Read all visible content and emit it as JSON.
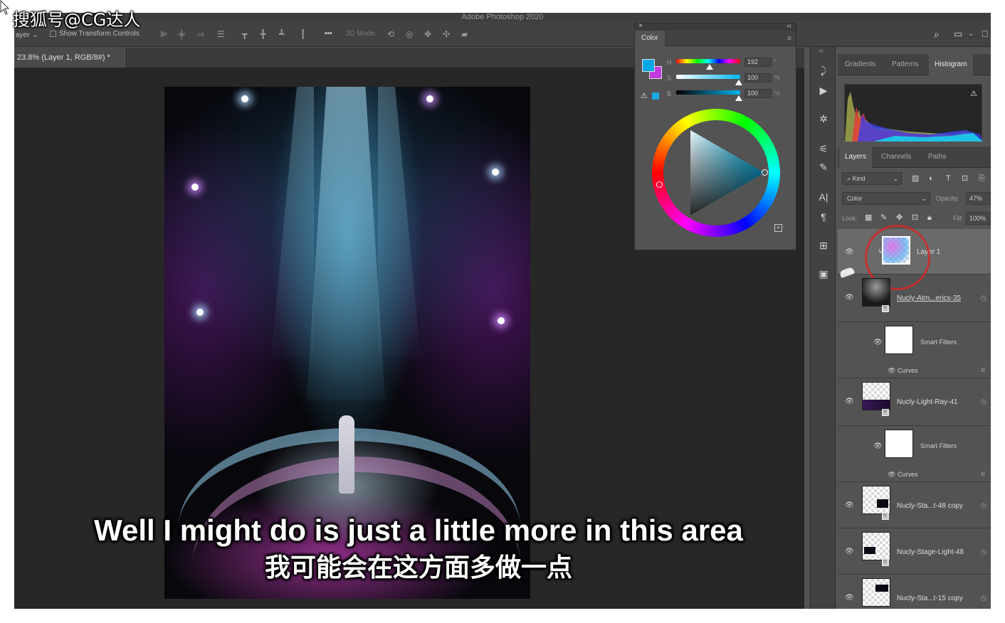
{
  "watermark": "搜狐号@CG达人",
  "app": {
    "title": "Adobe Photoshop 2020"
  },
  "options_bar": {
    "layer_select": "ayer",
    "show_transform": "Show Transform Controls",
    "more": "•••",
    "mode_3d": "3D Mode:"
  },
  "document": {
    "tab": "23.8% (Layer 1, RGB/8#) *"
  },
  "color_panel": {
    "title": "Color",
    "h_label": "H",
    "s_label": "S",
    "b_label": "B",
    "h": "192",
    "s": "100",
    "b": "100",
    "h_unit": "°",
    "s_unit": "%",
    "b_unit": "%",
    "fg_color": "#00a8e8",
    "bg_color": "#c43ae0"
  },
  "top_tabs": {
    "gradients": "Gradients",
    "patterns": "Patterns",
    "histogram": "Histogram"
  },
  "layers_tabs": {
    "layers": "Layers",
    "channels": "Channels",
    "paths": "Paths"
  },
  "layers_controls": {
    "kind": "Kind",
    "blend_mode": "Color",
    "opacity_label": "Opacity:",
    "opacity": "47%",
    "lock_label": "Lock:",
    "fill_label": "Fill:",
    "fill": "100%"
  },
  "layers": [
    {
      "name": "Layer 1"
    },
    {
      "name": "Nucly-Atm...erics-35"
    },
    {
      "name": "Smart Filters"
    },
    {
      "name": "Curves"
    },
    {
      "name": "Nucly-Light-Ray-41"
    },
    {
      "name": "Smart Filters"
    },
    {
      "name": "Curves"
    },
    {
      "name": "Nucly-Sta...t-48 copy"
    },
    {
      "name": "Nucly-Stage-Light-48"
    },
    {
      "name": "Nucly-Sta...t-15 copy"
    }
  ],
  "subtitles": {
    "en": "Well I might do is just a little more in this area",
    "zh": "我可能会在这方面多做一点"
  }
}
